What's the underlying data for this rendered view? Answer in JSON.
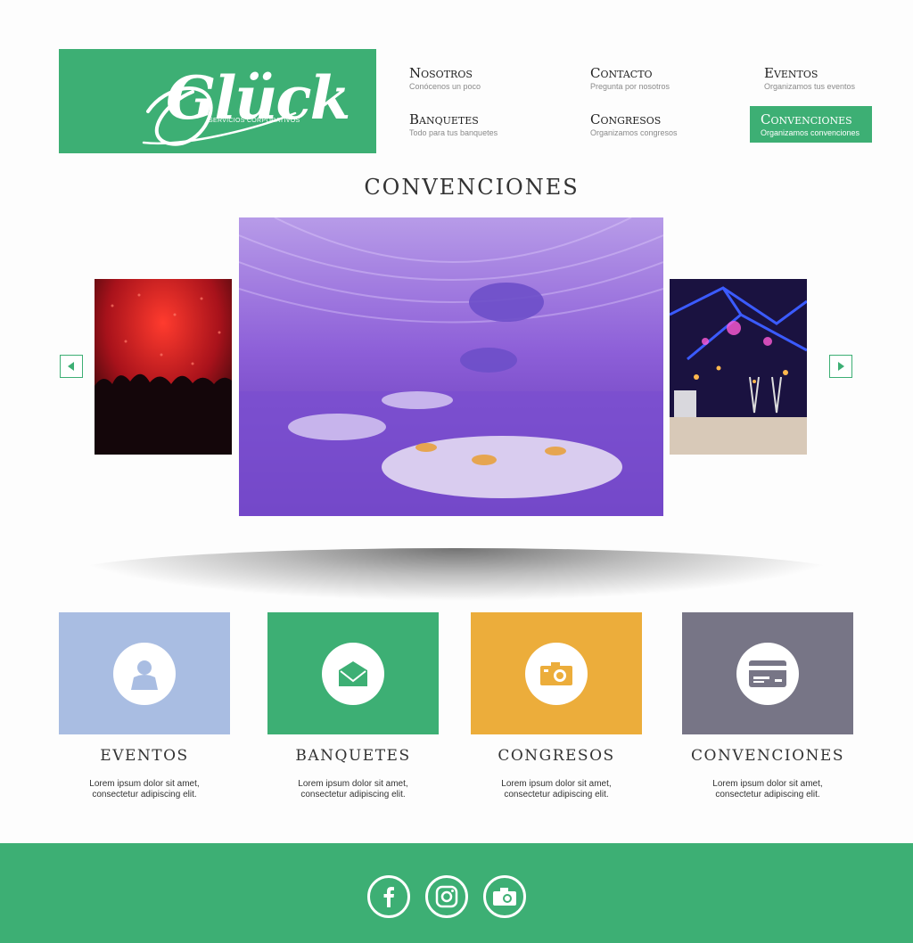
{
  "logo": {
    "word": "Glück",
    "tagline": "SERVICIOS CORPORATIVOS"
  },
  "nav": [
    {
      "title": "Nosotros",
      "subtitle": "Conócenos un poco"
    },
    {
      "title": "Contacto",
      "subtitle": "Pregunta por nosotros"
    },
    {
      "title": "Eventos",
      "subtitle": "Organizamos tus eventos"
    },
    {
      "title": "Banquetes",
      "subtitle": "Todo para tus banquetes"
    },
    {
      "title": "Congresos",
      "subtitle": "Organizamos congresos"
    },
    {
      "title": "Convenciones",
      "subtitle": "Organizamos convenciones",
      "active": true
    }
  ],
  "page_title": "CONVENCIONES",
  "carousel": {
    "slides": [
      "concert-crowd-photo",
      "banquet-hall-photo",
      "table-setting-photo"
    ],
    "prev_icon": "chevron-left-icon",
    "next_icon": "chevron-right-icon"
  },
  "cards": [
    {
      "title": "EVENTOS",
      "text": "Lorem ipsum dolor sit amet, consectetur adipiscing elit.",
      "color": "#a9bde2",
      "icon": "person-icon"
    },
    {
      "title": "BANQUETES",
      "text": "Lorem ipsum dolor sit amet, consectetur adipiscing elit.",
      "color": "#3daf74",
      "icon": "envelope-icon"
    },
    {
      "title": "CONGRESOS",
      "text": "Lorem ipsum dolor sit amet, consectetur adipiscing elit.",
      "color": "#ecad3b",
      "icon": "camera-icon"
    },
    {
      "title": "CONVENCIONES",
      "text": "Lorem ipsum dolor sit amet, consectetur adipiscing elit.",
      "color": "#777586",
      "icon": "credit-card-icon"
    }
  ],
  "footer": {
    "social": [
      "facebook-icon",
      "instagram-icon",
      "camera-icon"
    ]
  },
  "colors": {
    "brand": "#3daf74",
    "text": "#333333"
  }
}
